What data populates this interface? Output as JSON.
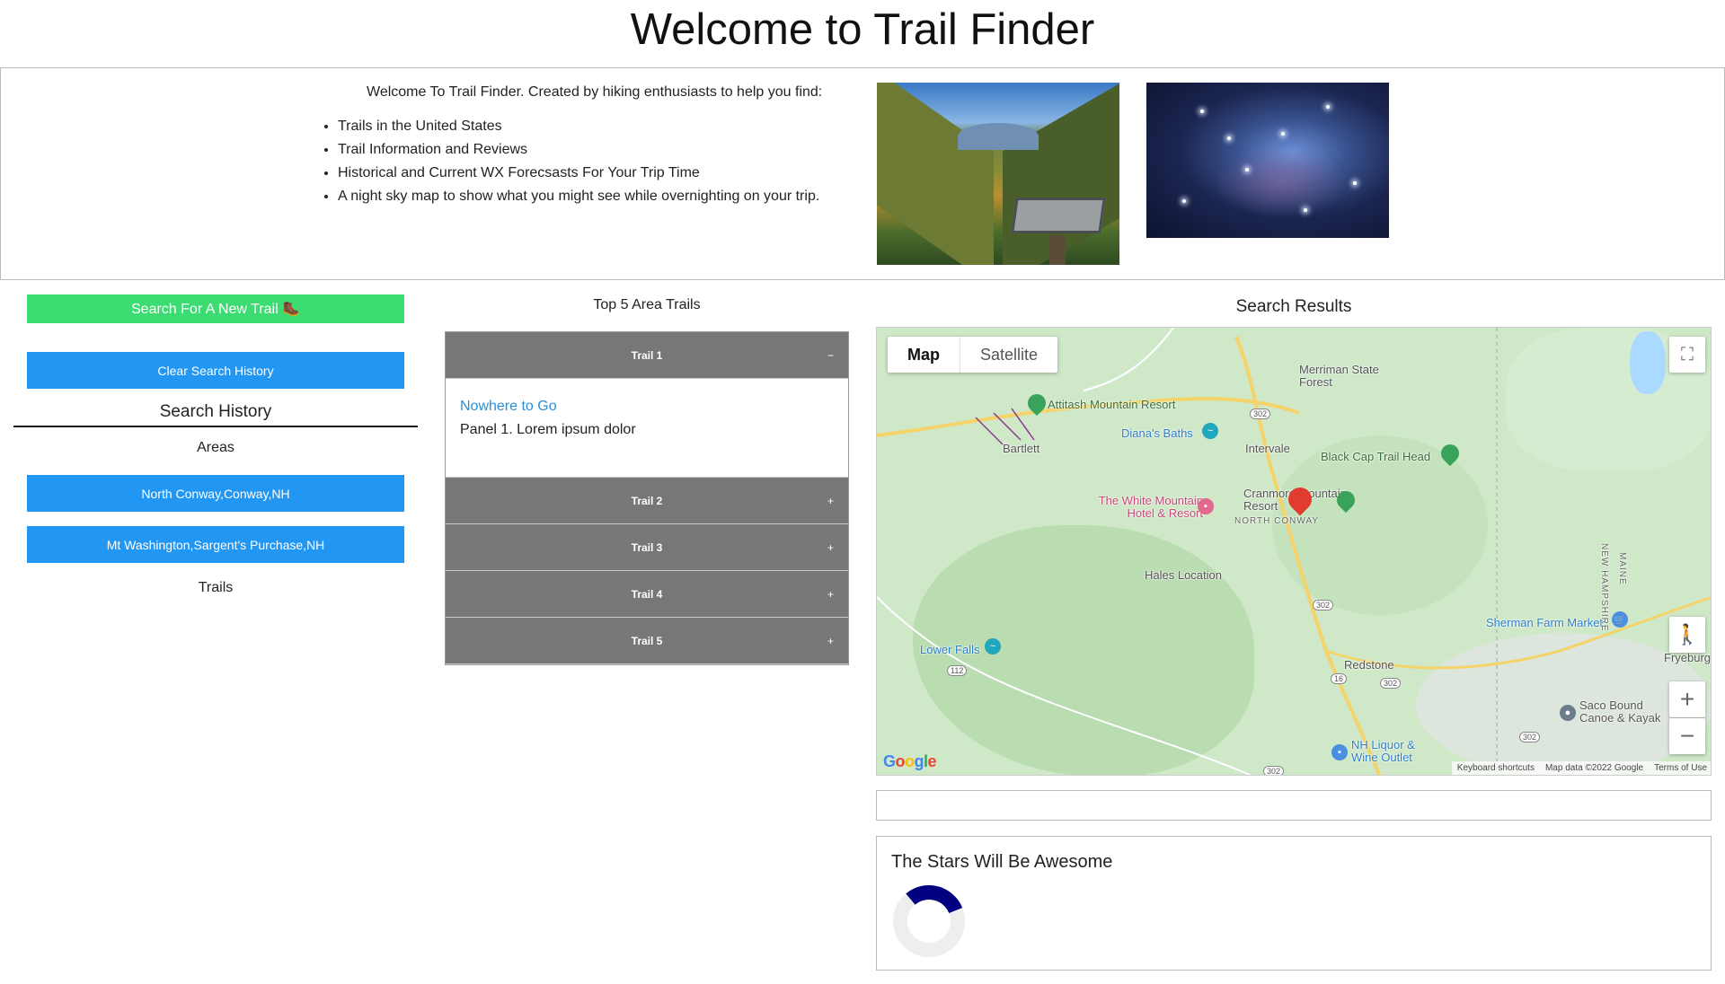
{
  "header": {
    "title": "Welcome to Trail Finder"
  },
  "intro": {
    "lead": "Welcome To Trail Finder. Created by hiking enthusiasts to help you find:",
    "bullets": [
      "Trails in the United States",
      "Trail Information and Reviews",
      "Historical and Current WX Forecsasts For Your Trip Time",
      "A night sky map to show what you might see while overnighting on your trip."
    ]
  },
  "sidebar": {
    "search_button": "Search For A New Trail 🥾",
    "clear_button": "Clear Search History",
    "history_title": "Search History",
    "areas_label": "Areas",
    "areas": [
      "North Conway,Conway,NH",
      "Mt Washington,Sargent's Purchase,NH"
    ],
    "trails_label": "Trails"
  },
  "top_trails": {
    "title": "Top 5 Area Trails",
    "items": [
      {
        "label": "Trail 1",
        "sign": "−",
        "expanded": true,
        "link": "Nowhere to Go",
        "text": "Panel 1. Lorem ipsum dolor"
      },
      {
        "label": "Trail 2",
        "sign": "+"
      },
      {
        "label": "Trail 3",
        "sign": "+"
      },
      {
        "label": "Trail 4",
        "sign": "+"
      },
      {
        "label": "Trail 5",
        "sign": "+"
      }
    ]
  },
  "results": {
    "title": "Search Results",
    "map": {
      "tab_map": "Map",
      "tab_satellite": "Satellite",
      "labels": {
        "merriman": "Merriman State Forest",
        "attitash": "Attitash Mountain Resort",
        "dianas": "Diana's Baths",
        "bartlett": "Bartlett",
        "intervale": "Intervale",
        "blackcap": "Black Cap Trail Head",
        "white_mountain": "The White Mountain Hotel & Resort",
        "cranmore": "Cranmore Mountain Resort",
        "north_conway": "NORTH CONWAY",
        "hales": "Hales Location",
        "sherman": "Sherman Farm Market",
        "fryeburg": "Fryeburg",
        "lower_falls": "Lower Falls",
        "redstone": "Redstone",
        "saco": "Saco Bound Canoe & Kayak",
        "nh_liquor": "NH Liquor & Wine Outlet",
        "new_hampshire": "NEW HAMPSHIRE",
        "maine": "MAINE"
      },
      "routes": [
        "302",
        "302",
        "302",
        "16",
        "302",
        "302",
        "112",
        "112"
      ],
      "attribution": [
        "Keyboard shortcuts",
        "Map data ©2022 Google",
        "Terms of Use"
      ]
    }
  },
  "stars": {
    "title": "The Stars Will Be Awesome",
    "gauge_fraction": 0.3,
    "gauge_color": "#000080",
    "track_color": "#eeeeee"
  },
  "colors": {
    "search_button": "#3ddc73",
    "blue_button": "#2196f3",
    "accordion_header": "#777777",
    "link": "#2b8fd6"
  }
}
